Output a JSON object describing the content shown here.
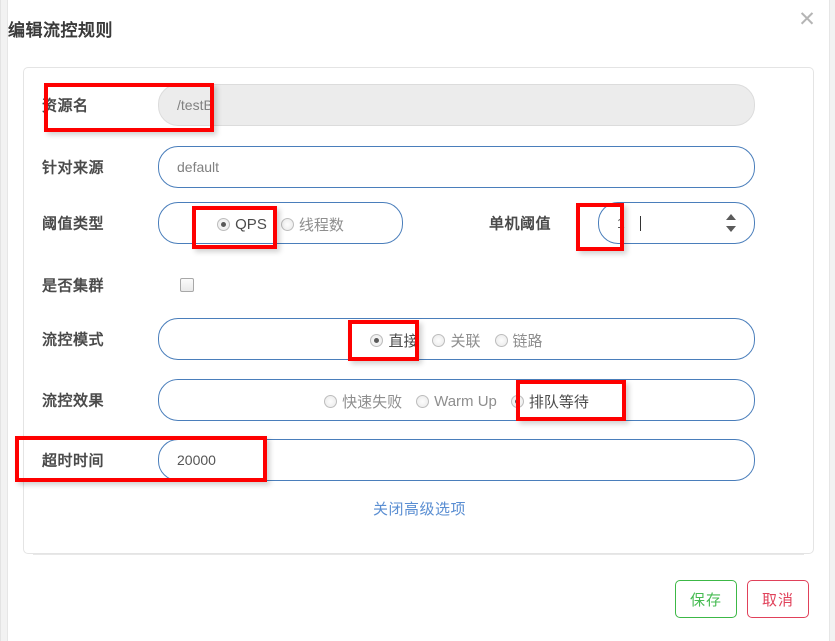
{
  "dialog": {
    "title": "编辑流控规则",
    "close_icon": "✕"
  },
  "form": {
    "rows": [
      {
        "label": "资源名",
        "value": "/testB",
        "type": "text-disabled"
      },
      {
        "label": "针对来源",
        "value": "default",
        "type": "text"
      },
      {
        "label": "阈值类型",
        "type": "radio",
        "options": [
          {
            "label": "QPS",
            "selected": true
          },
          {
            "label": "线程数",
            "selected": false
          }
        ],
        "side": {
          "label": "单机阈值",
          "value": "1",
          "type": "number",
          "has_spinner": true
        }
      },
      {
        "label": "是否集群",
        "type": "checkbox",
        "checked": false
      },
      {
        "label": "流控模式",
        "type": "radio",
        "options": [
          {
            "label": "直接",
            "selected": true
          },
          {
            "label": "关联",
            "selected": false
          },
          {
            "label": "链路",
            "selected": false
          }
        ]
      },
      {
        "label": "流控效果",
        "type": "radio",
        "options": [
          {
            "label": "快速失败",
            "selected": false
          },
          {
            "label": "Warm Up",
            "selected": false
          },
          {
            "label": "排队等待",
            "selected": true
          }
        ]
      },
      {
        "label": "超时时间",
        "value": "20000",
        "type": "text"
      }
    ],
    "advanced_link": "关闭高级选项"
  },
  "footer": {
    "save_label": "保存",
    "cancel_label": "取消"
  },
  "colors": {
    "accent_blue": "#4a7ebb",
    "link_blue": "#5a8ed2",
    "save_green": "#46bb52",
    "cancel_red": "#e0415a",
    "annotation_red": "#fe0000",
    "page_bg": "#f2f2f2"
  }
}
